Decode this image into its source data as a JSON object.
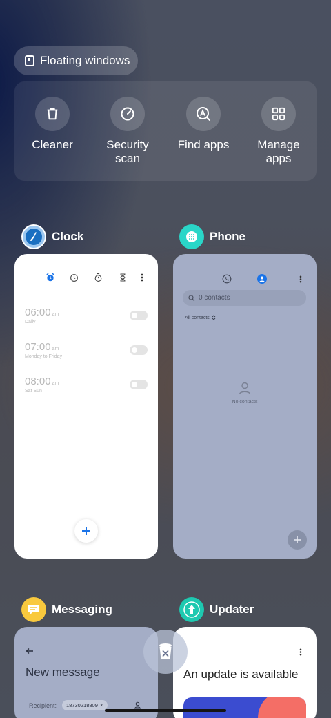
{
  "floating_windows": {
    "label": "Floating windows"
  },
  "quick_actions": [
    {
      "label": "Cleaner",
      "icon": "trash-icon"
    },
    {
      "label": "Security scan",
      "icon": "security-scan-icon"
    },
    {
      "label": "Find apps",
      "icon": "find-apps-icon"
    },
    {
      "label": "Manage apps",
      "icon": "manage-apps-icon"
    }
  ],
  "apps": {
    "clock": {
      "name": "Clock",
      "alarms": [
        {
          "time": "06:00",
          "ampm": "am",
          "repeat": "Daily"
        },
        {
          "time": "07:00",
          "ampm": "am",
          "repeat": "Monday to Friday"
        },
        {
          "time": "08:00",
          "ampm": "am",
          "repeat": "Sat Sun"
        }
      ]
    },
    "phone": {
      "name": "Phone",
      "search_placeholder": "0 contacts",
      "filter": "All contacts",
      "empty": "No contacts"
    },
    "messaging": {
      "name": "Messaging",
      "title": "New message",
      "recipient_label": "Recipient:",
      "recipient_value": "18730218809"
    },
    "updater": {
      "name": "Updater",
      "title": "An update is available"
    }
  },
  "colors": {
    "accent_blue": "#1b74e8",
    "phone_card": "#a4adc6",
    "phone_icon": "#2ad6c8",
    "messaging_icon": "#f9c93e",
    "updater_icon": "#1ec9b0"
  }
}
